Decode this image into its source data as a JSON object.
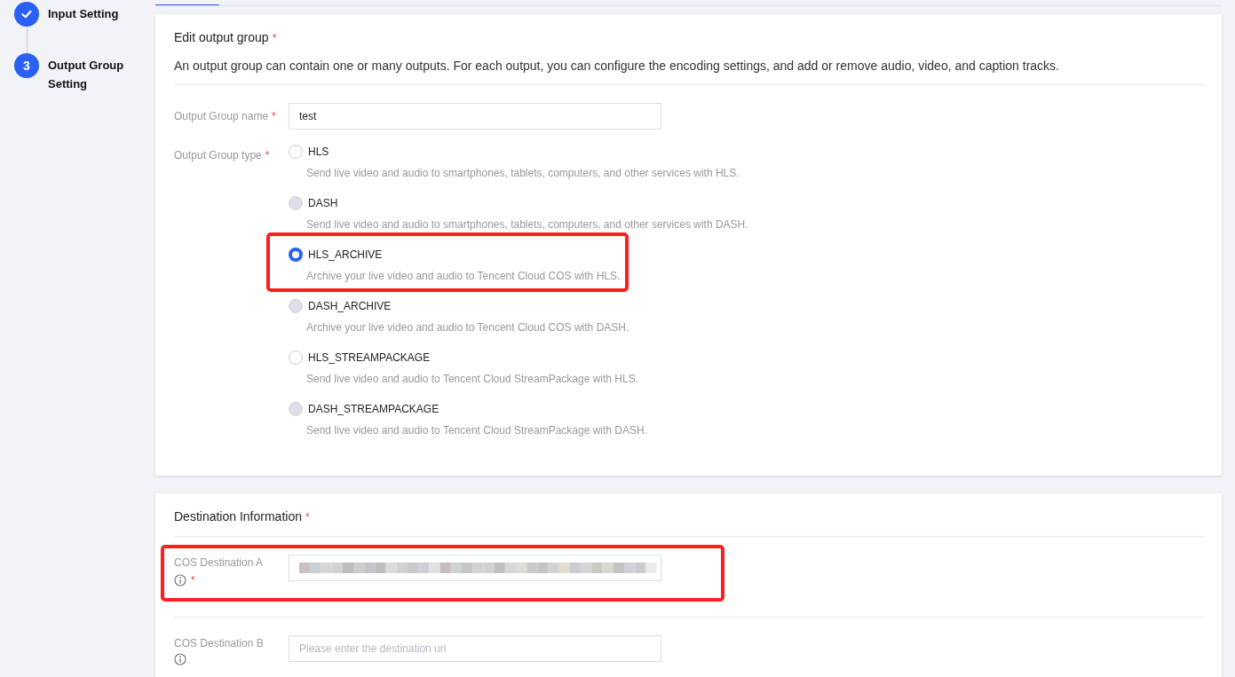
{
  "steps": [
    {
      "label": "Input Setting",
      "done": true
    },
    {
      "label": "Output Group Setting",
      "done": false,
      "number": "3"
    }
  ],
  "tabs": [
    {
      "selected": true
    }
  ],
  "output_group": {
    "title": "Edit output group",
    "required_mark": "*",
    "description": "An output group can contain one or many outputs. For each output, you can configure the encoding settings, and add or remove audio, video, and caption tracks.",
    "name_label": "Output Group name",
    "name_required_mark": "*",
    "name_value": "test",
    "type_label": "Output Group type",
    "type_required_mark": "*",
    "types": [
      {
        "label": "HLS",
        "description": "Send live video and audio to smartphones, tablets, computers, and other services with HLS.",
        "selected": false,
        "disabled": false,
        "highlighted": false
      },
      {
        "label": "DASH",
        "description": "Send live video and audio to smartphones, tablets, computers, and other services with DASH.",
        "selected": false,
        "disabled": true,
        "highlighted": false
      },
      {
        "label": "HLS_ARCHIVE",
        "description": "Archive your live video and audio to Tencent Cloud COS with HLS.",
        "selected": true,
        "disabled": false,
        "highlighted": true
      },
      {
        "label": "DASH_ARCHIVE",
        "description": "Archive your live video and audio to Tencent Cloud COS with DASH.",
        "selected": false,
        "disabled": true,
        "highlighted": false
      },
      {
        "label": "HLS_STREAMPACKAGE",
        "description": "Send live video and audio to Tencent Cloud StreamPackage with HLS.",
        "selected": false,
        "disabled": false,
        "highlighted": false
      },
      {
        "label": "DASH_STREAMPACKAGE",
        "description": "Send live video and audio to Tencent Cloud StreamPackage with DASH.",
        "selected": false,
        "disabled": true,
        "highlighted": false
      }
    ]
  },
  "destination": {
    "title": "Destination Information",
    "required_mark": "*",
    "fields": [
      {
        "label": "COS Destination A",
        "required_mark": "*",
        "redacted": true,
        "highlighted": true
      },
      {
        "label": "COS Destination B",
        "redacted": false,
        "placeholder": "Please enter the destination url",
        "highlighted": false
      }
    ]
  }
}
